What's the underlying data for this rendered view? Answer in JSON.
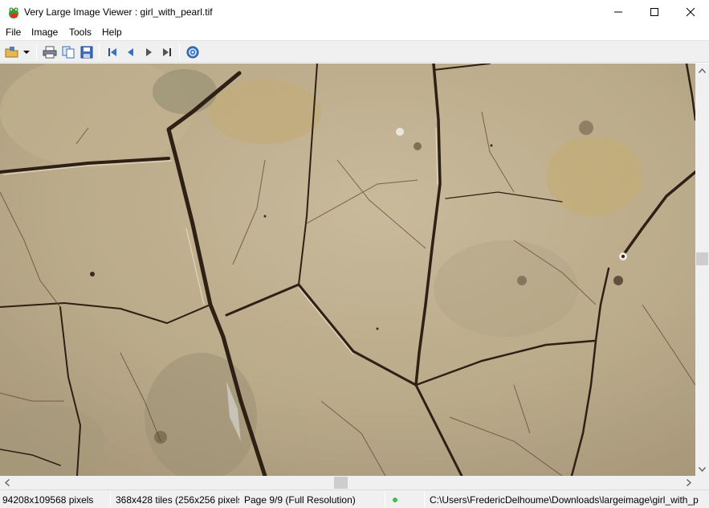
{
  "window": {
    "title": "Very Large Image Viewer : girl_with_pearl.tif",
    "app_icon": "frog-icon"
  },
  "menu": [
    "File",
    "Image",
    "Tools",
    "Help"
  ],
  "toolbar": {
    "buttons": [
      "open-icon",
      "dropdown-arrow-icon",
      "print-icon",
      "copy-icon",
      "save-icon",
      "first-page-icon",
      "previous-page-icon",
      "next-page-icon",
      "last-page-icon",
      "help-icon"
    ]
  },
  "viewer": {
    "content": "image-tile",
    "vertical_scroll_position": 0.47,
    "horizontal_scroll_position": 0.49
  },
  "status": {
    "dimensions": "94208x109568 pixels",
    "tiles": "368x428 tiles (256x256 pixels)",
    "page": "Page 9/9 (Full Resolution)",
    "indicator_color": "#3fbf4a",
    "path": "C:\\Users\\FredericDelhoume\\Downloads\\largeimage\\girl_with_p"
  }
}
